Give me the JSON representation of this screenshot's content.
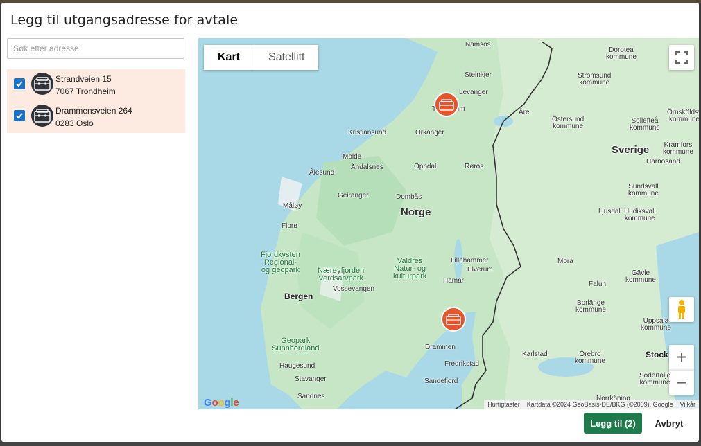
{
  "dialog": {
    "title": "Legg til utgangsadresse for avtale"
  },
  "search": {
    "placeholder": "Søk etter adresse",
    "value": ""
  },
  "addresses": [
    {
      "street": "Strandveien 15",
      "city": "7067 Trondheim",
      "checked": true,
      "icon": "briefcase-icon"
    },
    {
      "street": "Drammensveien 264",
      "city": "0283 Oslo",
      "checked": true,
      "icon": "briefcase-icon"
    }
  ],
  "map": {
    "map_type": {
      "map_label": "Kart",
      "satellite_label": "Satellitt",
      "selected": "Kart"
    },
    "country_labels": {
      "norway": "Norge",
      "sweden": "Sverige"
    },
    "place_labels": {
      "namsos": "Namsos",
      "steinkjer": "Steinkjer",
      "levanger": "Levanger",
      "trondheim": "Trondheim",
      "orkanger": "Orkanger",
      "kristiansund": "Kristiansund",
      "molde": "Molde",
      "andalsnes": "Åndalsnes",
      "alesund": "Ålesund",
      "oppdal": "Oppdal",
      "roros": "Røros",
      "geiranger": "Geiranger",
      "dombas": "Dombås",
      "maloy": "Måløy",
      "floro": "Florø",
      "lillehammer": "Lillehammer",
      "elverum": "Elverum",
      "hamar": "Hamar",
      "bergen": "Bergen",
      "vossevangen": "Vossevangen",
      "drammen": "Drammen",
      "haugesund": "Haugesund",
      "stavanger": "Stavanger",
      "sandnes": "Sandnes",
      "fredrikstad": "Fredrikstad",
      "sandefjord": "Sandefjord",
      "are": "Åre",
      "mora": "Mora",
      "falun": "Falun",
      "ljusdal": "Ljusdal",
      "karlstad": "Karlstad",
      "dorotea": "Dorotea\nkommune",
      "stromsund": "Strömsund\nkommune",
      "ostersund": "Östersund\nkommune",
      "sollefta": "Sollefteå\nkommune",
      "ornskoldsvik": "Örnsköldsv\nkommune",
      "kramfors": "Kramfors\nkommune",
      "harnosand": "Härnösand",
      "sundsvall": "Sundsvall\nkommune",
      "hudiksvall": "Hudiksvall\nkommune",
      "gavle": "Gävle\nkommune",
      "borlange": "Borlänge\nkommune",
      "uppsala": "Uppsala\nkommune",
      "orebro": "Örebro\nkommune",
      "stockholm": "Stock",
      "sodertalje": "Södertälje\nkommune",
      "norrkoping": "Norrköping"
    },
    "park_labels": {
      "fjordkysten": "Fjordkysten\nRegional-\nog geopark",
      "naeroyfjorden": "Nærøyfjorden\nVerdsarvpark",
      "valdres": "Valdres\nNatur- og\nkulturpark",
      "sunnhordland": "Geopark\nSunnhordland"
    },
    "google_logo": "Google",
    "attribution": {
      "shortcuts": "Hurtigtaster",
      "map_data": "Kartdata ©2024 GeoBasis-DE/BKG (©2009), Google",
      "terms": "Vilkår"
    },
    "zoom_in_symbol": "+",
    "zoom_out_symbol": "−",
    "marker_color": "#e8542a"
  },
  "footer": {
    "add_label": "Legg til (2)",
    "cancel_label": "Avbryt"
  },
  "colors": {
    "accent": "#1e7a4a",
    "checkbox": "#1a73c8",
    "selected_row_bg": "#fdeae0"
  }
}
